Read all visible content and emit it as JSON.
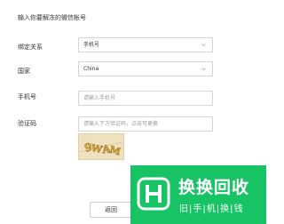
{
  "title": "输入你要解冻的微信帐号",
  "form": {
    "relation": {
      "label": "绑定关系",
      "value": "手机号",
      "chevron_icon": "chevron-down-icon"
    },
    "country": {
      "label": "国家",
      "value": "China",
      "chevron_icon": "chevron-down-icon"
    },
    "phone": {
      "label": "手机号",
      "placeholder": "请输入手机号"
    },
    "code": {
      "label": "验证码",
      "placeholder": "请输入下方验证码，点击可更换"
    },
    "captcha": {
      "text": "9WAM",
      "icon": "captcha-image"
    }
  },
  "back_button": {
    "label": "返回"
  },
  "watermark": {
    "name": "换换回收",
    "tagline": "旧|手|机|换|钱",
    "background_color": "#17c364",
    "logo_icon": "huanhuan-logo-icon"
  }
}
